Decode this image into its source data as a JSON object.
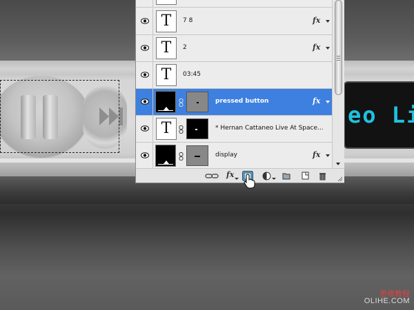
{
  "layers_panel": {
    "layers": [
      {
        "name": "7          8",
        "thumb": "text",
        "fx": true,
        "selected": false
      },
      {
        "name": "2",
        "thumb": "text",
        "fx": true,
        "selected": false
      },
      {
        "name": "03:45",
        "thumb": "text",
        "fx": false,
        "selected": false
      },
      {
        "name": "pressed button",
        "thumb": "black",
        "mask": "grey",
        "fx": true,
        "selected": true
      },
      {
        "name": "* Hernan Cattaneo Live At Space...",
        "thumb": "text",
        "mask": "black",
        "fx": false,
        "selected": false
      },
      {
        "name": "display",
        "thumb": "black",
        "mask": "grey",
        "fx": true,
        "selected": false
      }
    ],
    "thumb_glyph": "T",
    "fx_label": "fx",
    "toolbar_icons": [
      "link-layers-icon",
      "layer-style-icon",
      "add-mask-icon",
      "adjustment-layer-icon",
      "new-group-icon",
      "new-layer-icon",
      "trash-icon"
    ],
    "selection_color": "#3d80df"
  },
  "player": {
    "display_text": "eo Liv",
    "display_color": "#1fc1e0"
  },
  "watermark": {
    "cn": "思缘教程",
    "en": "OLIHE.COM"
  }
}
